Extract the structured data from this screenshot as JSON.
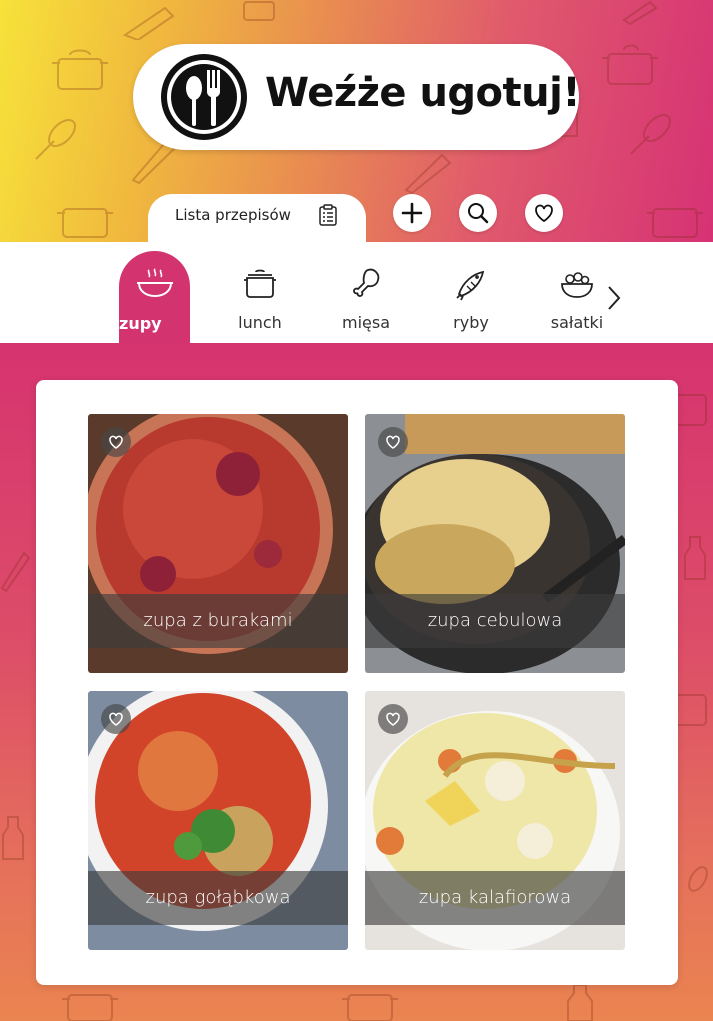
{
  "app": {
    "title": "Weźże ugotuj!"
  },
  "tabs": {
    "list_label": "Lista przepisów"
  },
  "icons": {
    "logo": "fork-spoon-logo-icon",
    "list": "clipboard-icon",
    "add": "plus-icon",
    "search": "search-icon",
    "favorites": "heart-icon",
    "next": "chevron-right-icon"
  },
  "categories": [
    {
      "label": "zupy",
      "icon": "soup-bowl-icon",
      "active": true
    },
    {
      "label": "lunch",
      "icon": "pot-icon",
      "active": false
    },
    {
      "label": "mięsa",
      "icon": "chicken-leg-icon",
      "active": false
    },
    {
      "label": "ryby",
      "icon": "fish-icon",
      "active": false
    },
    {
      "label": "sałatki",
      "icon": "salad-bowl-icon",
      "active": false
    }
  ],
  "recipes": [
    {
      "title": "zupa z burakami",
      "favorite": false
    },
    {
      "title": "zupa cebulowa",
      "favorite": false
    },
    {
      "title": "zupa gołąbkowa",
      "favorite": false
    },
    {
      "title": "zupa kalafiorowa",
      "favorite": false
    }
  ],
  "colors": {
    "accent": "#d3346f",
    "gradient_start": "#f7e23a",
    "gradient_end": "#d63274"
  }
}
